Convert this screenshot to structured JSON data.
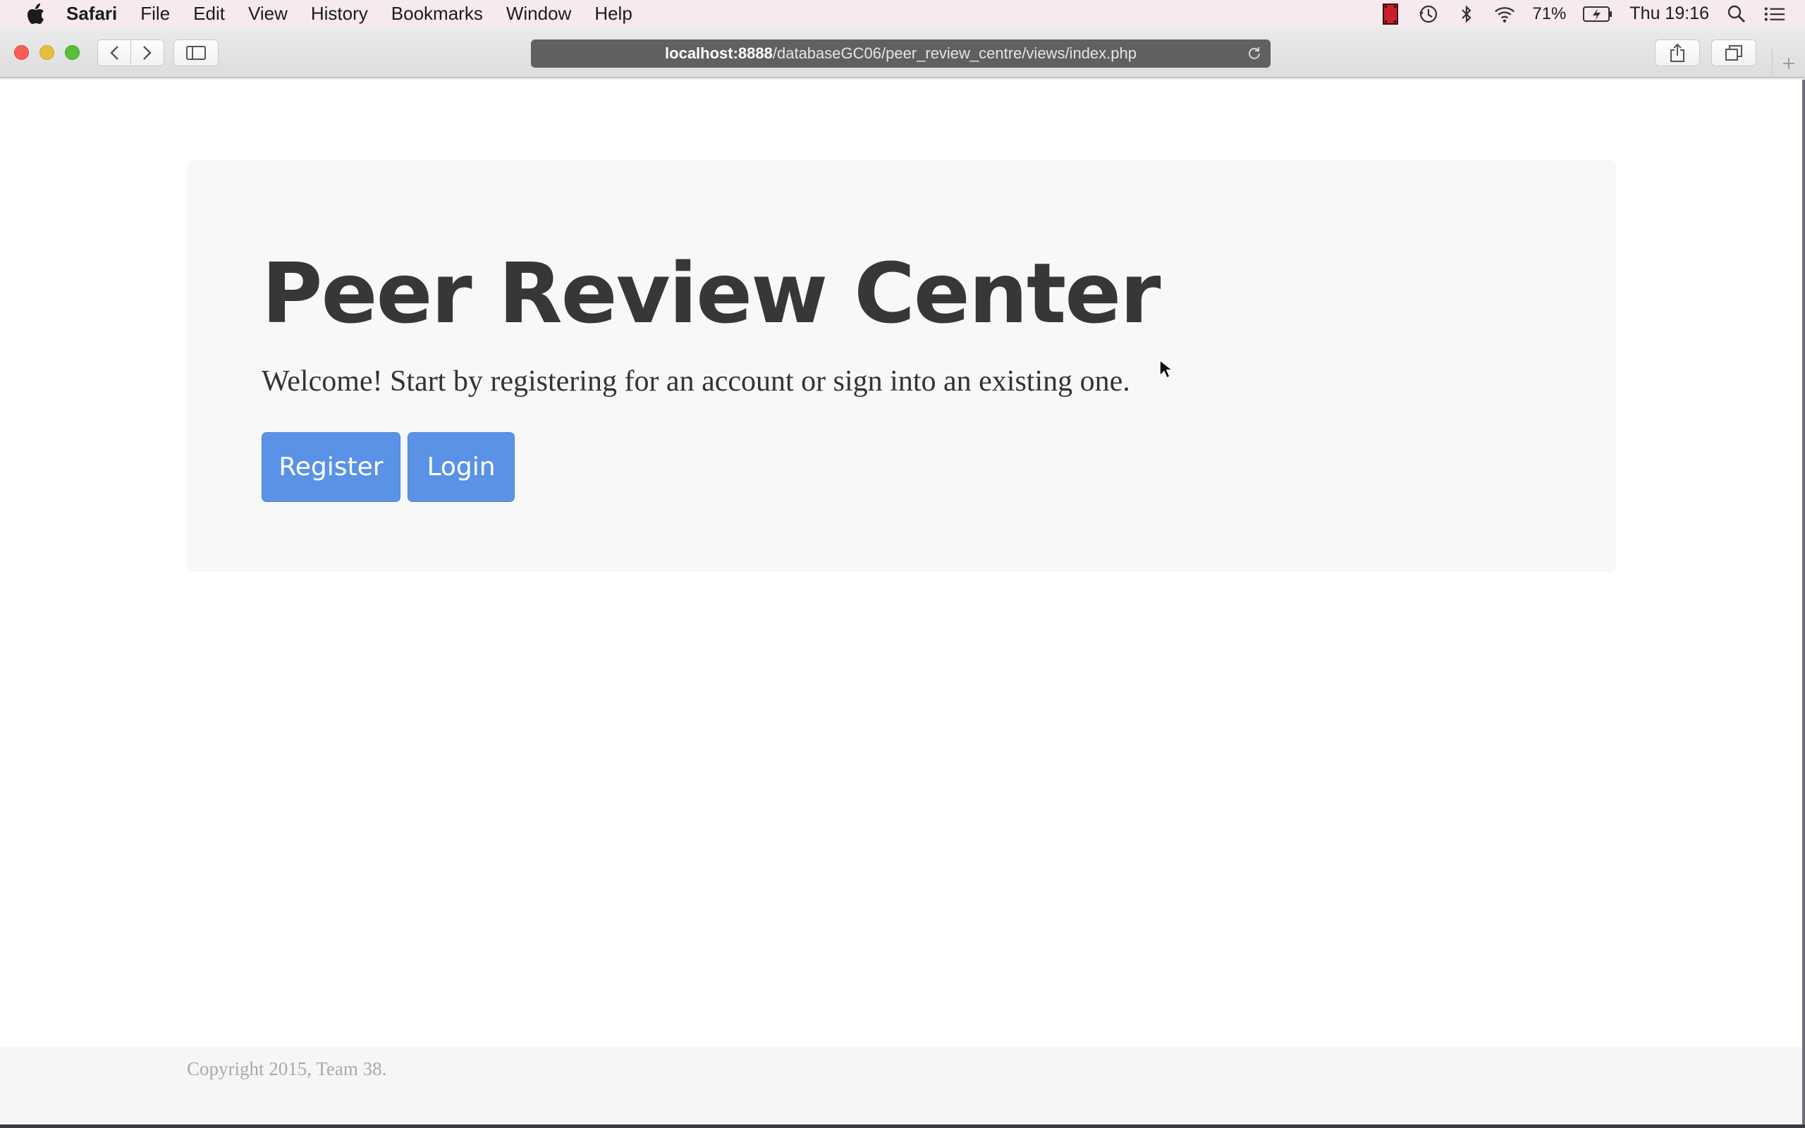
{
  "menubar": {
    "app_name": "Safari",
    "items": [
      "File",
      "Edit",
      "View",
      "History",
      "Bookmarks",
      "Window",
      "Help"
    ],
    "battery_percent": "71%",
    "clock": "Thu 19:16"
  },
  "browser": {
    "url_host": "localhost:8888",
    "url_path": "/databaseGC06/peer_review_centre/views/index.php"
  },
  "page": {
    "title": "Peer Review Center",
    "lead": "Welcome! Start by registering for an account or sign into an existing one.",
    "register_label": "Register",
    "login_label": "Login",
    "copyright": "Copyright 2015, Team 38."
  },
  "colors": {
    "button": "#5a93e6",
    "jumbotron": "#f8f8f8",
    "title": "#373737"
  }
}
